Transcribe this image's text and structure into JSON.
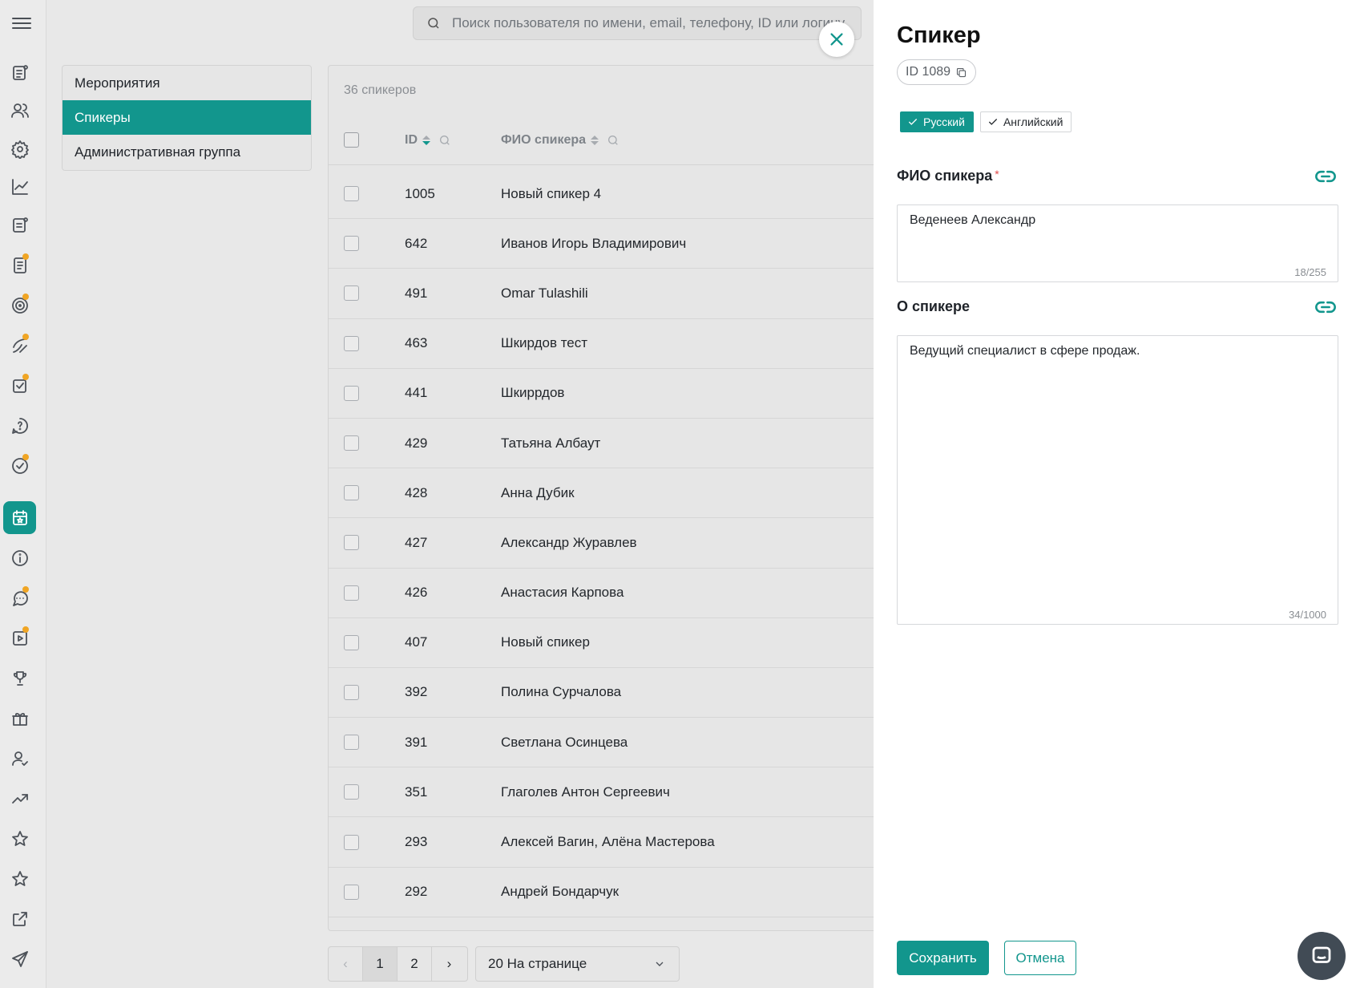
{
  "search": {
    "placeholder": "Поиск пользователя по имени, email, телефону, ID или логину"
  },
  "subnav": {
    "items": [
      "Мероприятия",
      "Спикеры",
      "Административная группа"
    ]
  },
  "table": {
    "count_label": "36 спикеров",
    "columns": {
      "id": "ID",
      "name": "ФИО спикера"
    },
    "rows": [
      {
        "id": "1005",
        "name": "Новый спикер 4"
      },
      {
        "id": "642",
        "name": "Иванов Игорь Владимирович"
      },
      {
        "id": "491",
        "name": "Omar Tulashili"
      },
      {
        "id": "463",
        "name": "Шкирдов тест"
      },
      {
        "id": "441",
        "name": "Шкиррдов"
      },
      {
        "id": "429",
        "name": "Татьяна Албаут"
      },
      {
        "id": "428",
        "name": "Анна Дубик"
      },
      {
        "id": "427",
        "name": "Александр Журавлев"
      },
      {
        "id": "426",
        "name": "Анастасия Карпова"
      },
      {
        "id": "407",
        "name": "Новый спикер"
      },
      {
        "id": "392",
        "name": "Полина Сурчалова"
      },
      {
        "id": "391",
        "name": "Светлана Осинцева"
      },
      {
        "id": "351",
        "name": "Глаголев Антон Сергеевич"
      },
      {
        "id": "293",
        "name": "Алексей Вагин, Алёна Мастерова"
      },
      {
        "id": "292",
        "name": "Андрей Бондарчук"
      }
    ]
  },
  "pagination": {
    "pages": [
      "1",
      "2"
    ],
    "current": "1",
    "per_page": "20 На странице"
  },
  "panel": {
    "title": "Спикер",
    "id_label": "ID 1089",
    "languages": [
      "Русский",
      "Английский"
    ],
    "active_language": "Русский",
    "fio_label": "ФИО спикера",
    "fio_required": "*",
    "fio_value": "Веденеев Александр",
    "fio_counter": "18/255",
    "about_label": "О спикере",
    "about_value": "Ведущий специалист в сфере продаж.",
    "about_counter": "34/1000",
    "save_label": "Сохранить",
    "cancel_label": "Отмена"
  },
  "colors": {
    "accent": "#12968d",
    "notification_dot": "#f0a524",
    "required": "#e14b4b"
  },
  "icons": {
    "rail": [
      "menu-icon",
      "news-icon",
      "users-icon",
      "settings-icon",
      "analytics-icon",
      "feed-icon",
      "document-icon",
      "target-icon",
      "skills-icon",
      "tasks-icon",
      "help-icon",
      "check-icon",
      "events-calendar-icon",
      "info-icon",
      "chat-icon",
      "video-icon",
      "trophy-icon",
      "gift-icon",
      "user-check-icon",
      "trending-icon",
      "star-icon",
      "star-outline-icon",
      "external-link-icon",
      "send-icon"
    ]
  }
}
